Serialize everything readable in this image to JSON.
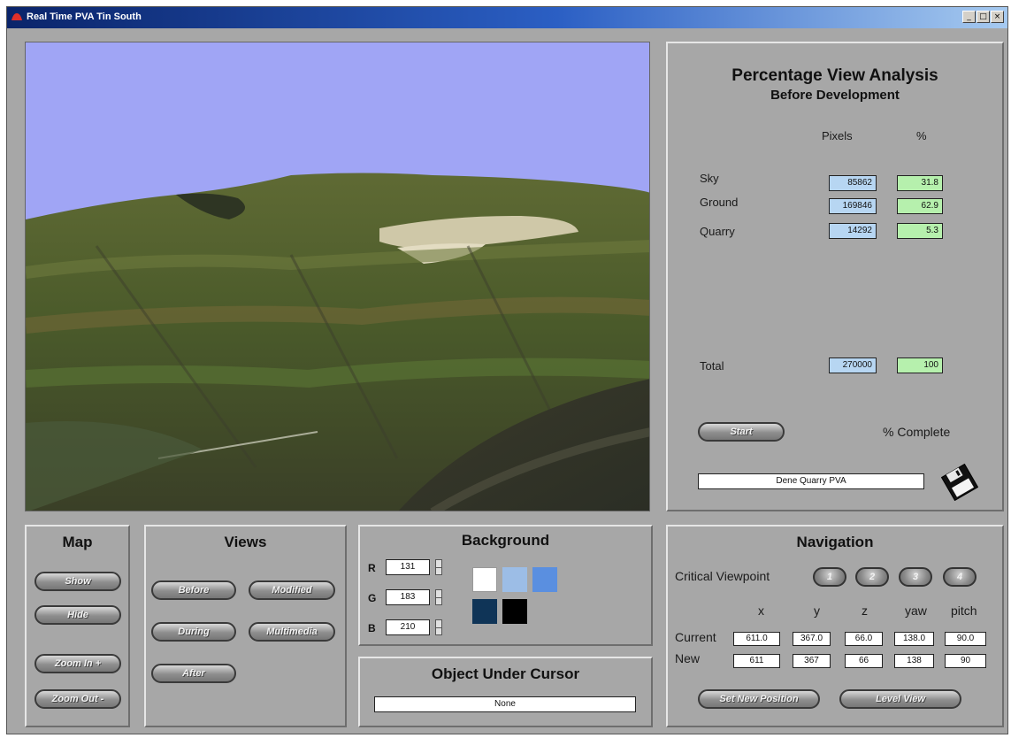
{
  "window": {
    "title": "Real Time PVA Tin South",
    "controls": [
      "_",
      "□",
      "×"
    ]
  },
  "pva": {
    "title": "Percentage View Analysis",
    "subtitle": "Before Development",
    "col_pixels": "Pixels",
    "col_percent": "%",
    "rows": [
      {
        "label": "Sky",
        "pixels": "85862",
        "percent": "31.8"
      },
      {
        "label": "Ground",
        "pixels": "169846",
        "percent": "62.9"
      },
      {
        "label": "Quarry",
        "pixels": "14292",
        "percent": "5.3"
      }
    ],
    "total": {
      "label": "Total",
      "pixels": "270000",
      "percent": "100"
    },
    "start_label": "Start",
    "complete_label": "% Complete",
    "filename": "Dene Quarry PVA",
    "save_icon": "floppy-disk-icon"
  },
  "map": {
    "title": "Map",
    "buttons": [
      "Show",
      "Hide",
      "Zoom In +",
      "Zoom Out -"
    ]
  },
  "views": {
    "title": "Views",
    "buttons": [
      "Before",
      "Modified",
      "During",
      "Multimedia",
      "After"
    ]
  },
  "background": {
    "title": "Background",
    "r_label": "R",
    "r_value": "131",
    "g_label": "G",
    "g_value": "183",
    "b_label": "B",
    "b_value": "210",
    "swatches": [
      "#ffffff",
      "#9cbde6",
      "#5a8fe0",
      "#0f3457",
      "#000000"
    ]
  },
  "object": {
    "title": "Object Under Cursor",
    "value": "None"
  },
  "navigation": {
    "title": "Navigation",
    "critical_label": "Critical Viewpoint",
    "viewpoints": [
      "1",
      "2",
      "3",
      "4"
    ],
    "columns": [
      "x",
      "y",
      "z",
      "yaw",
      "pitch"
    ],
    "current_label": "Current",
    "current": [
      "611.0",
      "367.0",
      "66.0",
      "138.0",
      "90.0"
    ],
    "new_label": "New",
    "new": [
      "611",
      "367",
      "66",
      "138",
      "90"
    ],
    "set_position_label": "Set New Position",
    "level_view_label": "Level View"
  },
  "colors": {
    "sky": "#a0a5f5",
    "panel": "#a7a7a7",
    "title_bar": "#0a246a"
  }
}
